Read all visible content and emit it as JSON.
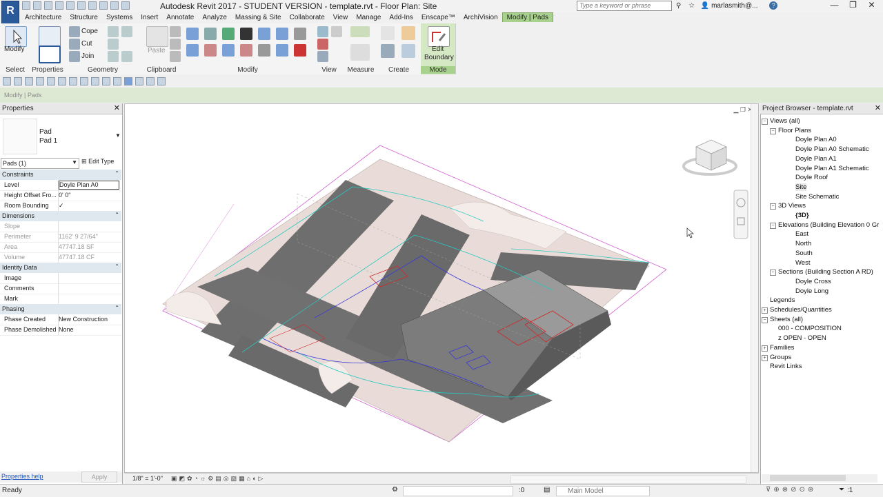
{
  "app": {
    "window_title": "Autodesk Revit 2017 - STUDENT VERSION -    template.rvt - Floor Plan: Site",
    "logo_letter": "R",
    "search_placeholder": "Type a keyword or phrase",
    "username": "marlasmith@..."
  },
  "tabs": [
    "Architecture",
    "Structure",
    "Systems",
    "Insert",
    "Annotate",
    "Analyze",
    "Massing & Site",
    "Collaborate",
    "View",
    "Manage",
    "Add-Ins",
    "Enscape™",
    "ArchiVision",
    "Modify | Pads"
  ],
  "ribbon": {
    "modify_label": "Modify",
    "select_label": "Select",
    "properties_label": "Properties",
    "geometry_label": "Geometry",
    "cope_label": "Cope",
    "cut_label": "Cut",
    "join_label": "Join",
    "paste_label": "Paste",
    "clipboard_label": "Clipboard",
    "modify_panel_label": "Modify",
    "view_label": "View",
    "measure_label": "Measure",
    "create_label": "Create",
    "edit_boundary_label_1": "Edit",
    "edit_boundary_label_2": "Boundary",
    "mode_label": "Mode"
  },
  "context_bar": {
    "label": "Modify | Pads"
  },
  "properties": {
    "title": "Properties",
    "family": "Pad",
    "type": "Pad 1",
    "instance_filter": "Pads (1)",
    "edit_type": "Edit Type",
    "sections": [
      {
        "name": "Constraints",
        "rows": [
          {
            "k": "Level",
            "v": "Doyle Plan A0",
            "disabled": false
          },
          {
            "k": "Height Offset Fro...",
            "v": "0'  0\"",
            "disabled": false
          },
          {
            "k": "Room Bounding",
            "v": "✓",
            "disabled": false
          }
        ]
      },
      {
        "name": "Dimensions",
        "rows": [
          {
            "k": "Slope",
            "v": "",
            "disabled": true
          },
          {
            "k": "Perimeter",
            "v": "1162'  9 27/64\"",
            "disabled": true
          },
          {
            "k": "Area",
            "v": "47747.18 SF",
            "disabled": true
          },
          {
            "k": "Volume",
            "v": "47747.18 CF",
            "disabled": true
          }
        ]
      },
      {
        "name": "Identity Data",
        "rows": [
          {
            "k": "Image",
            "v": "",
            "disabled": false
          },
          {
            "k": "Comments",
            "v": "",
            "disabled": false
          },
          {
            "k": "Mark",
            "v": "",
            "disabled": false
          }
        ]
      },
      {
        "name": "Phasing",
        "rows": [
          {
            "k": "Phase Created",
            "v": "New Construction",
            "disabled": false
          },
          {
            "k": "Phase Demolished",
            "v": "None",
            "disabled": false
          }
        ]
      }
    ],
    "help_link": "Properties help",
    "apply": "Apply"
  },
  "view": {
    "scale": "1/8\" = 1'-0\""
  },
  "project_browser": {
    "title": "Project Browser - template.rvt",
    "items": [
      {
        "label": "Views (all)",
        "level": 0,
        "toggle": "−"
      },
      {
        "label": "Floor Plans",
        "level": 1,
        "toggle": "−"
      },
      {
        "label": "Doyle Plan A0",
        "level": 2,
        "toggle": ""
      },
      {
        "label": "Doyle Plan A0 Schematic",
        "level": 2,
        "toggle": ""
      },
      {
        "label": "Doyle Plan A1",
        "level": 2,
        "toggle": ""
      },
      {
        "label": "Doyle Plan A1 Schematic",
        "level": 2,
        "toggle": ""
      },
      {
        "label": "Doyle Roof",
        "level": 2,
        "toggle": ""
      },
      {
        "label": "Site",
        "level": 2,
        "toggle": ""
      },
      {
        "label": "Site Schematic",
        "level": 2,
        "toggle": ""
      },
      {
        "label": "3D Views",
        "level": 1,
        "toggle": "−"
      },
      {
        "label": "{3D}",
        "level": 2,
        "toggle": ""
      },
      {
        "label": "Elevations (Building Elevation 0 Gr",
        "level": 1,
        "toggle": "−"
      },
      {
        "label": "East",
        "level": 2,
        "toggle": ""
      },
      {
        "label": "North",
        "level": 2,
        "toggle": ""
      },
      {
        "label": "South",
        "level": 2,
        "toggle": ""
      },
      {
        "label": "West",
        "level": 2,
        "toggle": ""
      },
      {
        "label": "Sections (Building Section A RD)",
        "level": 1,
        "toggle": "−"
      },
      {
        "label": "Doyle Cross",
        "level": 2,
        "toggle": ""
      },
      {
        "label": "Doyle Long",
        "level": 2,
        "toggle": ""
      },
      {
        "label": "Legends",
        "level": 0,
        "toggle": ""
      },
      {
        "label": "Schedules/Quantities",
        "level": 0,
        "toggle": "+"
      },
      {
        "label": "Sheets (all)",
        "level": 0,
        "toggle": "−"
      },
      {
        "label": "000 - COMPOSITION",
        "level": 1,
        "toggle": ""
      },
      {
        "label": "z OPEN - OPEN",
        "level": 1,
        "toggle": ""
      },
      {
        "label": "Families",
        "level": 0,
        "toggle": "+"
      },
      {
        "label": "Groups",
        "level": 0,
        "toggle": "+"
      },
      {
        "label": "Revit Links",
        "level": 0,
        "toggle": ""
      }
    ]
  },
  "status": {
    "text": "Ready",
    "selection_count": ":0",
    "model": "Main Model",
    "filter_count": ":1"
  },
  "colors": {
    "context_green": "#a9d18e",
    "site_surface": "#e8dcd8",
    "road": "#6e6e6e",
    "contour": "#28c8c0",
    "property_line": "#d060d0"
  }
}
